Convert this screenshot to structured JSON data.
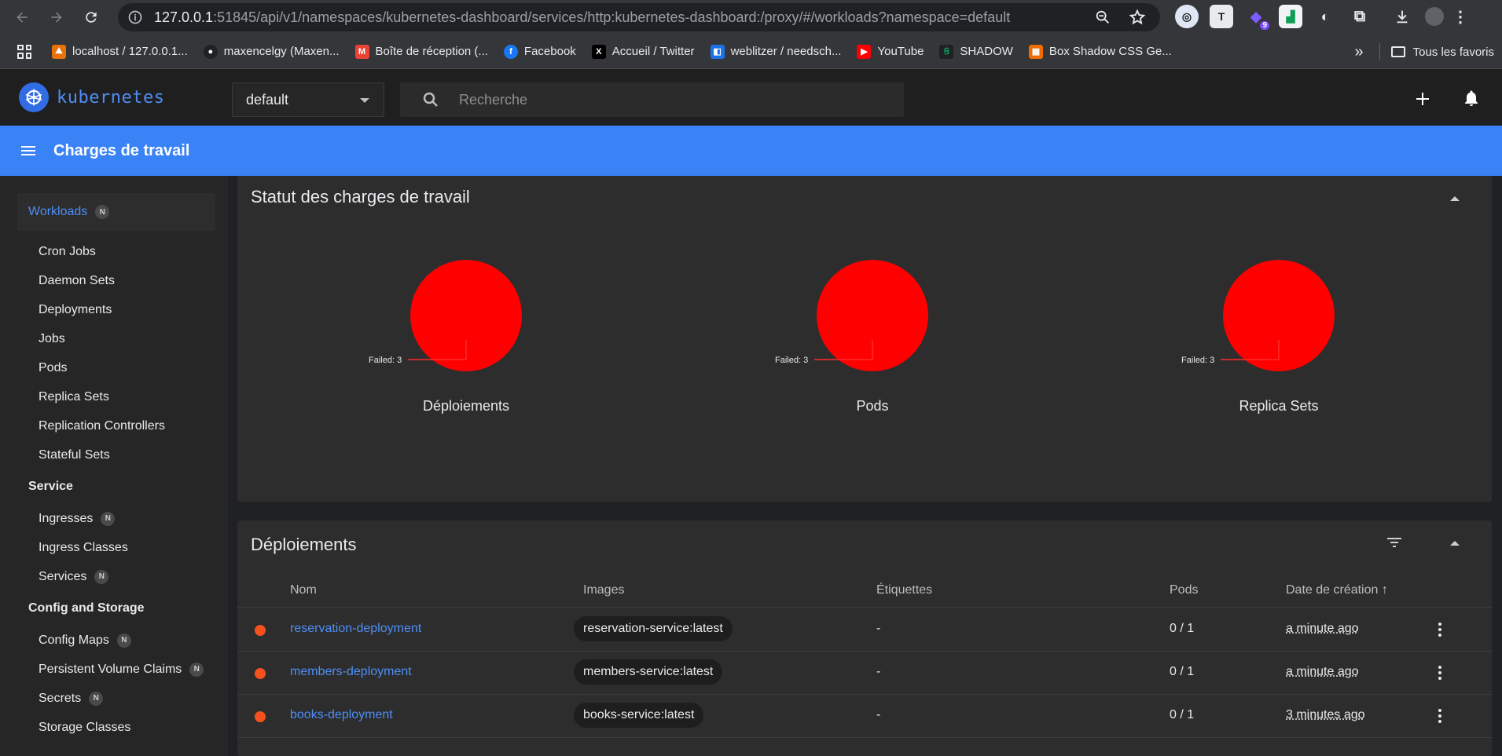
{
  "browser": {
    "url_host": "127.0.0.1",
    "url_rest": ":51845/api/v1/namespaces/kubernetes-dashboard/services/http:kubernetes-dashboard:/proxy/#/workloads?namespace=default",
    "ext_badge": "9"
  },
  "bookmarks": [
    {
      "label": "localhost / 127.0.0.1...",
      "color": "#e8710a",
      "glyph": "⛰"
    },
    {
      "label": "maxencelgy (Maxen...",
      "color": "#202124",
      "glyph": "●"
    },
    {
      "label": "Boîte de réception (...",
      "color": "#ea4335",
      "glyph": "M"
    },
    {
      "label": "Facebook",
      "color": "#1877f2",
      "glyph": "f"
    },
    {
      "label": "Accueil / Twitter",
      "color": "#000000",
      "glyph": "X"
    },
    {
      "label": "weblitzer / needsch...",
      "color": "#1a73e8",
      "glyph": "◧"
    },
    {
      "label": "YouTube",
      "color": "#ff0000",
      "glyph": "▶"
    },
    {
      "label": "SHADOW",
      "color": "#202124",
      "glyph": "Ꞩ"
    },
    {
      "label": "Box Shadow CSS Ge...",
      "color": "#ef6c00",
      "glyph": "▦"
    }
  ],
  "bookmarks_more": "»",
  "bookmarks_all": "Tous les favoris",
  "app": {
    "brand": "kubernetes",
    "namespace": "default",
    "search_placeholder": "Recherche",
    "toolbar_title": "Charges de travail"
  },
  "sidebar": {
    "workloads_label": "Workloads",
    "badge": "N",
    "workload_items": [
      "Cron Jobs",
      "Daemon Sets",
      "Deployments",
      "Jobs",
      "Pods",
      "Replica Sets",
      "Replication Controllers",
      "Stateful Sets"
    ],
    "service_group": "Service",
    "service_items": [
      "Ingresses",
      "Ingress Classes",
      "Services"
    ],
    "config_group": "Config and Storage",
    "config_items": [
      "Config Maps",
      "Persistent Volume Claims",
      "Secrets",
      "Storage Classes"
    ]
  },
  "status_card": {
    "title": "Statut des charges de travail",
    "charts": [
      {
        "label": "Déploiements",
        "legend": "Failed: 3"
      },
      {
        "label": "Pods",
        "legend": "Failed: 3"
      },
      {
        "label": "Replica Sets",
        "legend": "Failed: 3"
      }
    ]
  },
  "chart_data": [
    {
      "type": "pie",
      "title": "Déploiements",
      "series": [
        {
          "name": "Failed",
          "value": 3,
          "color": "#ff0000"
        }
      ]
    },
    {
      "type": "pie",
      "title": "Pods",
      "series": [
        {
          "name": "Failed",
          "value": 3,
          "color": "#ff0000"
        }
      ]
    },
    {
      "type": "pie",
      "title": "Replica Sets",
      "series": [
        {
          "name": "Failed",
          "value": 3,
          "color": "#ff0000"
        }
      ]
    }
  ],
  "deployments": {
    "title": "Déploiements",
    "columns": {
      "name": "Nom",
      "images": "Images",
      "labels": "Étiquettes",
      "pods": "Pods",
      "created": "Date de création",
      "sort_arrow": "↑"
    },
    "rows": [
      {
        "name": "reservation-deployment",
        "image": "reservation-service:latest",
        "labels": "-",
        "pods": "0 / 1",
        "created": "a minute ago"
      },
      {
        "name": "members-deployment",
        "image": "members-service:latest",
        "labels": "-",
        "pods": "0 / 1",
        "created": "a minute ago"
      },
      {
        "name": "books-deployment",
        "image": "books-service:latest",
        "labels": "-",
        "pods": "0 / 1",
        "created": "3 minutes ago"
      }
    ]
  },
  "colors": {
    "accent": "#3a83f7",
    "failed": "#ff0000",
    "status_dot": "#f4511e",
    "link": "#4e8ef7"
  }
}
